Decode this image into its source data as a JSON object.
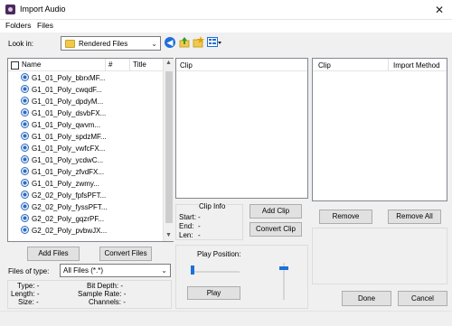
{
  "window": {
    "title": "Import Audio",
    "close_glyph": "✕"
  },
  "menu": {
    "items": [
      "Folders",
      "Files"
    ]
  },
  "lookin": {
    "label": "Look in:",
    "value": "Rendered Files"
  },
  "file_list": {
    "columns": [
      "Name",
      "#",
      "Title"
    ],
    "files": [
      "G1_01_Poly_bbrxMF...",
      "G1_01_Poly_cwqdF...",
      "G1_01_Poly_dpdyM...",
      "G1_01_Poly_dsvbFX...",
      "G1_01_Poly_qwvm...",
      "G1_01_Poly_spdzMF...",
      "G1_01_Poly_vwfcFX...",
      "G1_01_Poly_ycdwC...",
      "G1_01_Poly_zfvdFX...",
      "G1_01_Poly_zwmy...",
      "G2_02_Poly_fpfsPFT...",
      "G2_02_Poly_fyssPFT...",
      "G2_02_Poly_gqzrPF...",
      "G2_02_Poly_pvbwJX..."
    ]
  },
  "buttons": {
    "add_files": "Add Files",
    "convert_files": "Convert Files",
    "add_clip": "Add Clip",
    "convert_clip": "Convert Clip",
    "remove": "Remove",
    "remove_all": "Remove All",
    "play": "Play",
    "done": "Done",
    "cancel": "Cancel"
  },
  "files_of_type": {
    "label": "Files of type:",
    "value": "All Files (*.*)"
  },
  "file_info": {
    "type": "Type: -",
    "length": "Length: -",
    "size": "Size: -",
    "bit_depth": "Bit Depth: -",
    "sample_rate": "Sample Rate: -",
    "channels": "Channels: -"
  },
  "clip_panel": {
    "header": "Clip"
  },
  "clip_info": {
    "title": "Clip Info",
    "start_label": "Start:",
    "start_value": "-",
    "end_label": "End:",
    "end_value": "-",
    "len_label": "Len:",
    "len_value": "-"
  },
  "import_list": {
    "columns": [
      "Clip",
      "Import Method"
    ]
  },
  "play_position": {
    "label": "Play Position:",
    "slider_level": 0,
    "volume_level": 1
  },
  "colors": {
    "accent": "#1e6fd9",
    "folder": "#f2c94c",
    "button_face": "#e1e1e1"
  }
}
